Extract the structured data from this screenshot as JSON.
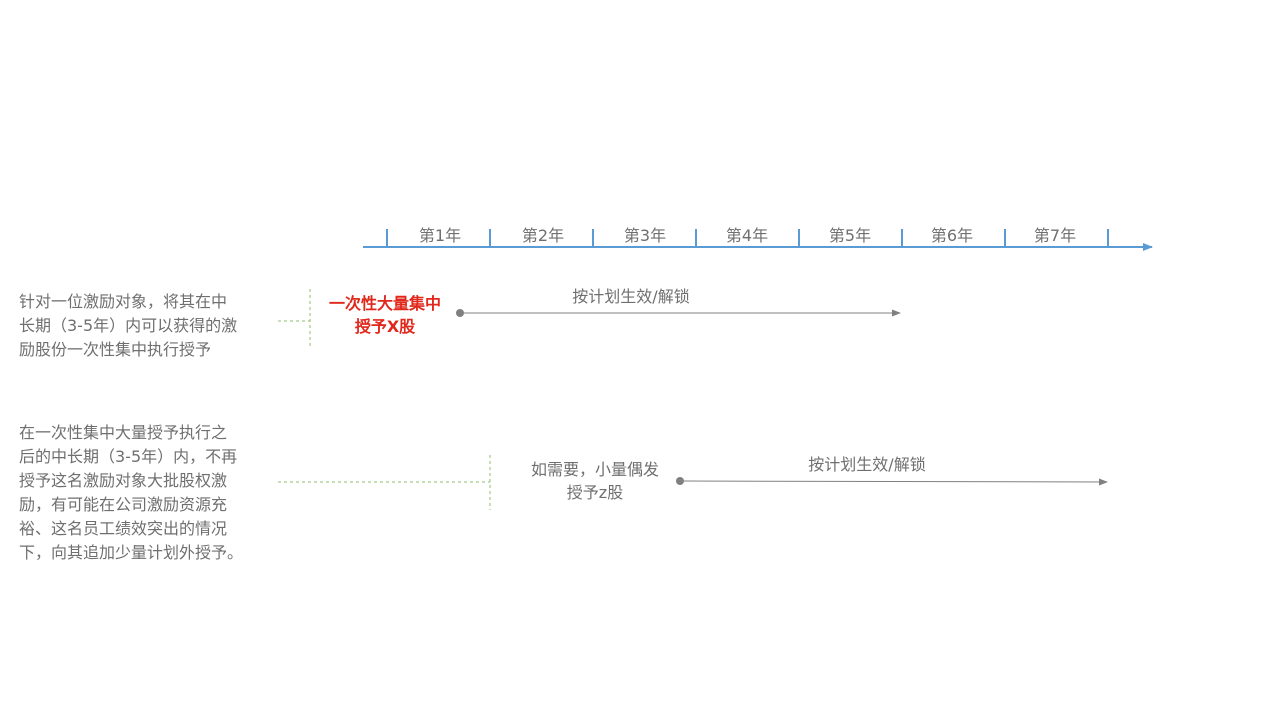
{
  "timeline": {
    "years": [
      "第1年",
      "第2年",
      "第3年",
      "第4年",
      "第5年",
      "第6年",
      "第7年"
    ],
    "axis_color": "#5b9bd5"
  },
  "row1": {
    "description_lines": [
      "针对一位激励对象，将其在中",
      "长期（3-5年）内可以获得的激",
      "励股份一次性集中执行授予"
    ],
    "grant_lines": [
      "一次性大量集中",
      "授予X股"
    ],
    "grant_color": "#e0281c",
    "arrow_label": "按计划生效/解锁"
  },
  "row2": {
    "description_lines": [
      "在一次性集中大量授予执行之",
      "后的中长期（3-5年）内，不再",
      "授予这名激励对象大批股权激",
      "励，有可能在公司激励资源充",
      "裕、这名员工绩效突出的情况",
      "下，向其追加少量计划外授予。"
    ],
    "grant_lines": [
      "如需要，小量偶发",
      "授予z股"
    ],
    "arrow_label": "按计划生效/解锁"
  }
}
